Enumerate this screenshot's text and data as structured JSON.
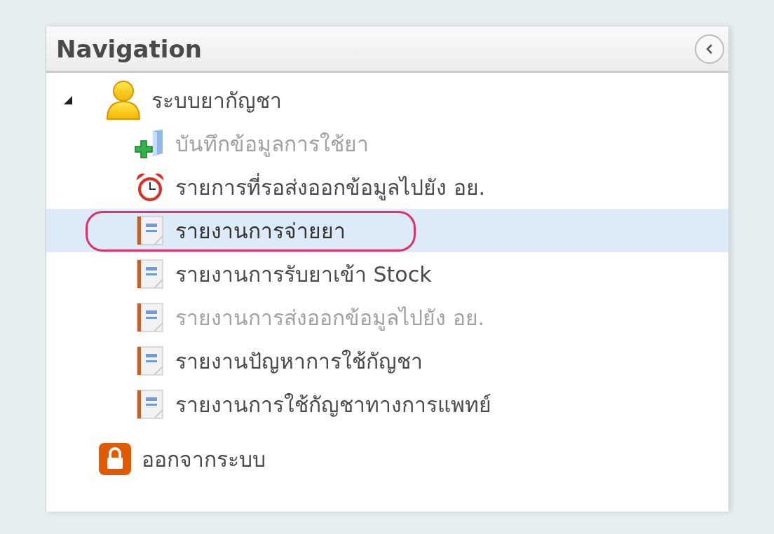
{
  "panel": {
    "title": "Navigation"
  },
  "tree": [
    {
      "label": "ระบบยากัญชา",
      "kind": "group",
      "expanded": true,
      "disabled": false,
      "selected": false,
      "circled": false,
      "children": [
        {
          "label": "บันทึกข้อมูลการใช้ยา",
          "kind": "add",
          "disabled": true,
          "selected": false,
          "circled": false
        },
        {
          "label": "รายการที่รอส่งออกข้อมูลไปยัง อย.",
          "kind": "alarm",
          "disabled": false,
          "selected": false,
          "circled": false
        },
        {
          "label": "รายงานการจ่ายยา",
          "kind": "report",
          "disabled": false,
          "selected": true,
          "circled": true
        },
        {
          "label": "รายงานการรับยาเข้า Stock",
          "kind": "report",
          "disabled": false,
          "selected": false,
          "circled": false
        },
        {
          "label": "รายงานการส่งออกข้อมูลไปยัง อย.",
          "kind": "report",
          "disabled": true,
          "selected": false,
          "circled": false
        },
        {
          "label": "รายงานปัญหาการใช้กัญชา",
          "kind": "report",
          "disabled": false,
          "selected": false,
          "circled": false
        },
        {
          "label": "รายงานการใช้กัญชาทางการแพทย์",
          "kind": "report",
          "disabled": false,
          "selected": false,
          "circled": false
        }
      ]
    },
    {
      "label": "ออกจากระบบ",
      "kind": "logout",
      "disabled": false,
      "selected": false,
      "circled": false
    }
  ]
}
